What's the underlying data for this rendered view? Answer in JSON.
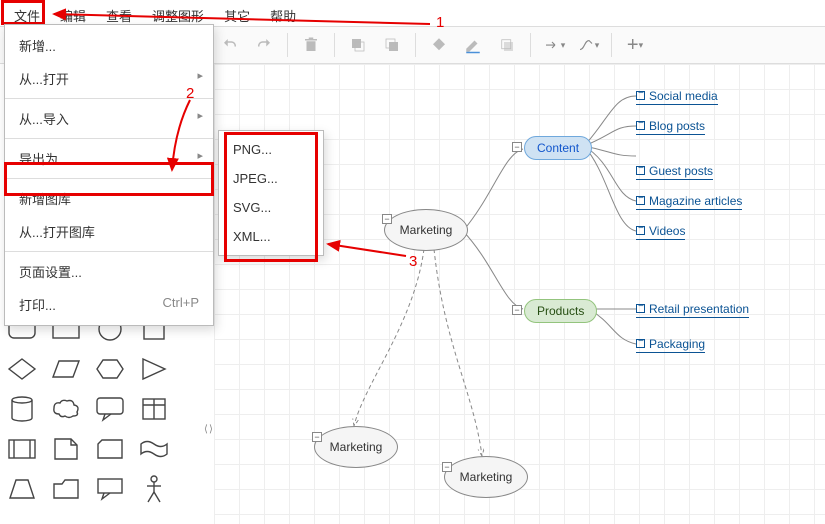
{
  "menu": {
    "items": [
      "文件",
      "编辑",
      "查看",
      "调整图形",
      "其它",
      "帮助"
    ]
  },
  "dropdown": {
    "new": "新增...",
    "open": "从...打开",
    "import": "从...导入",
    "export": "导出为",
    "newlib": "新增图库",
    "openlib": "从...打开图库",
    "page": "页面设置...",
    "print": "打印...",
    "print_shortcut": "Ctrl+P"
  },
  "submenu": {
    "png": "PNG...",
    "jpeg": "JPEG...",
    "svg": "SVG...",
    "xml": "XML..."
  },
  "annotations": {
    "a1": "1",
    "a2": "2",
    "a3": "3"
  },
  "diagram": {
    "root": "Marketing",
    "content": "Content",
    "products": "Products",
    "child1": "Marketing",
    "child2": "Marketing",
    "leaves_content": [
      "Social media",
      "Blog posts",
      "Guest posts",
      "Magazine articles",
      "Videos"
    ],
    "leaves_products": [
      "Retail presentation",
      "Packaging"
    ]
  }
}
